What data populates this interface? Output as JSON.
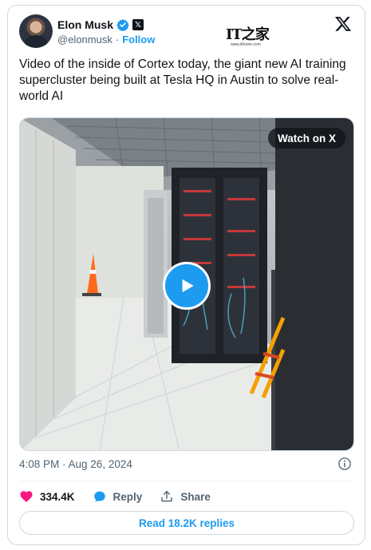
{
  "author": {
    "name": "Elon Musk",
    "handle": "@elonmusk",
    "separator": "·",
    "follow_label": "Follow"
  },
  "watermark": {
    "logo_text": "IT之家",
    "url": "www.ithome.com"
  },
  "tweet": {
    "text": "Video of the inside of Cortex today, the giant new AI training supercluster being built at Tesla HQ in Austin to solve real-world AI"
  },
  "media": {
    "watch_label": "Watch on X"
  },
  "meta": {
    "timestamp": "4:08 PM · Aug 26, 2024"
  },
  "actions": {
    "likes": "334.4K",
    "reply_label": "Reply",
    "share_label": "Share"
  },
  "read_replies_label": "Read 18.2K replies",
  "colors": {
    "accent": "#1d9bf0",
    "like": "#f91880",
    "text": "#0f1419",
    "muted": "#536471"
  }
}
